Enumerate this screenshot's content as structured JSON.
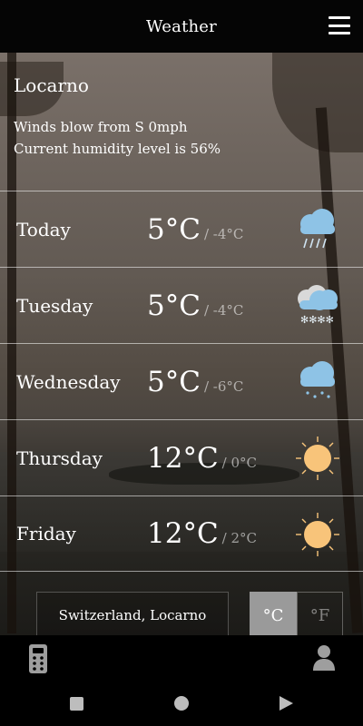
{
  "app": {
    "title": "Weather"
  },
  "location": {
    "city": "Locarno",
    "wind_text": "Winds blow from S 0mph",
    "humidity_text": "Current humidity level is 56%"
  },
  "forecast": [
    {
      "day": "Today",
      "high": "5°C",
      "low": "/ -4°C",
      "icon": "rain-cloud-icon"
    },
    {
      "day": "Tuesday",
      "high": "5°C",
      "low": "/ -4°C",
      "icon": "snow-cloud-icon"
    },
    {
      "day": "Wednesday",
      "high": "5°C",
      "low": "/ -6°C",
      "icon": "drizzle-cloud-icon"
    },
    {
      "day": "Thursday",
      "high": "12°C",
      "low": "/ 0°C",
      "icon": "sun-icon"
    },
    {
      "day": "Friday",
      "high": "12°C",
      "low": "/ 2°C",
      "icon": "sun-icon"
    }
  ],
  "controls": {
    "location_label": "Switzerland, Locarno",
    "unit_c": "°C",
    "unit_f": "°F",
    "selected_unit": "C"
  },
  "colors": {
    "sun": "#f8c47a",
    "cloud": "#8ec3e6",
    "unit_selected_bg": "#9a9a9a"
  }
}
